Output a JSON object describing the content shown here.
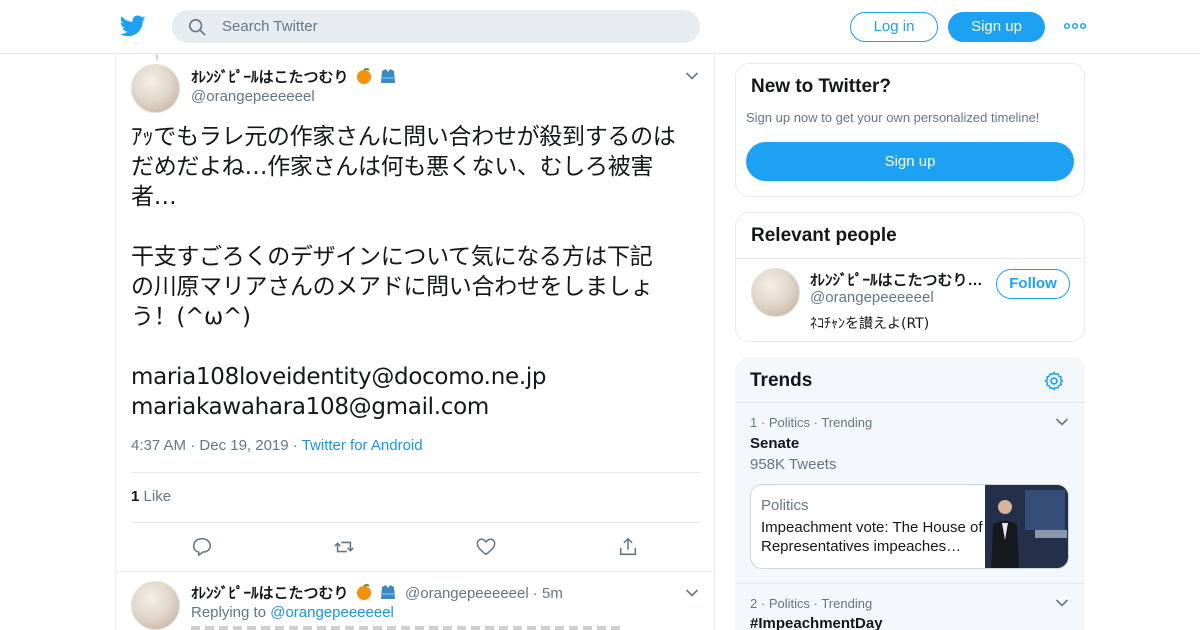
{
  "topbar": {
    "logo": "twitter-bird-icon",
    "search_placeholder": "Search Twitter",
    "login_label": "Log in",
    "signup_label": "Sign up",
    "more": "more-icon"
  },
  "main_tweet": {
    "author_name": "ｵﾚﾝｼﾞﾋﾟｰﾙはこたつむり",
    "author_handle": "@orangepeeeeeel",
    "text": "ｱｯでもラレ元の作家さんに問い合わせが殺到するのは\nだめだよね…作家さんは何も悪くない、むしろ被害\n者…\n\n干支すごろくのデザインについて気になる方は下記\nの川原マリアさんのメアドに問い合わせをしましょ\nう！(^ω^)\n\nmaria108loveidentity@docomo.ne.jp\nmariakawahara108@gmail.com",
    "time": "4:37 AM",
    "date": "Dec 19, 2019",
    "source": "Twitter for Android",
    "like_count": "1",
    "like_label": "Like"
  },
  "reply_tweet": {
    "author_name": "ｵﾚﾝｼﾞﾋﾟｰﾙはこたつむり",
    "author_handle": "@orangepeeeeeel",
    "age": "5m",
    "replying_label": "Replying to",
    "replying_handle": "@orangepeeeeeel"
  },
  "new_to_twitter": {
    "title": "New to Twitter?",
    "subtitle": "Sign up now to get your own personalized timeline!",
    "button": "Sign up"
  },
  "relevant_people": {
    "title": "Relevant people",
    "name": "ｵﾚﾝｼﾞﾋﾟｰﾙはこたつむり…",
    "handle": "@orangepeeeeeel",
    "bio": "ﾈｺﾁｬﾝを讃えよ(RT)",
    "follow_label": "Follow"
  },
  "trends": {
    "title": "Trends",
    "items": [
      {
        "rank": "1",
        "category": "Politics",
        "status": "Trending",
        "name": "Senate",
        "count": "958K Tweets"
      },
      {
        "rank": "2",
        "category": "Politics",
        "status": "Trending",
        "name": "#ImpeachmentDay"
      }
    ],
    "news": {
      "category": "Politics",
      "headline": "Impeachment vote: The House of Representatives impeaches…"
    }
  },
  "colors": {
    "accent": "#1da1f2",
    "link": "#1b95e0",
    "muted": "#657786",
    "border": "#e6ecf0",
    "trends_bg": "#f5f8fa"
  }
}
